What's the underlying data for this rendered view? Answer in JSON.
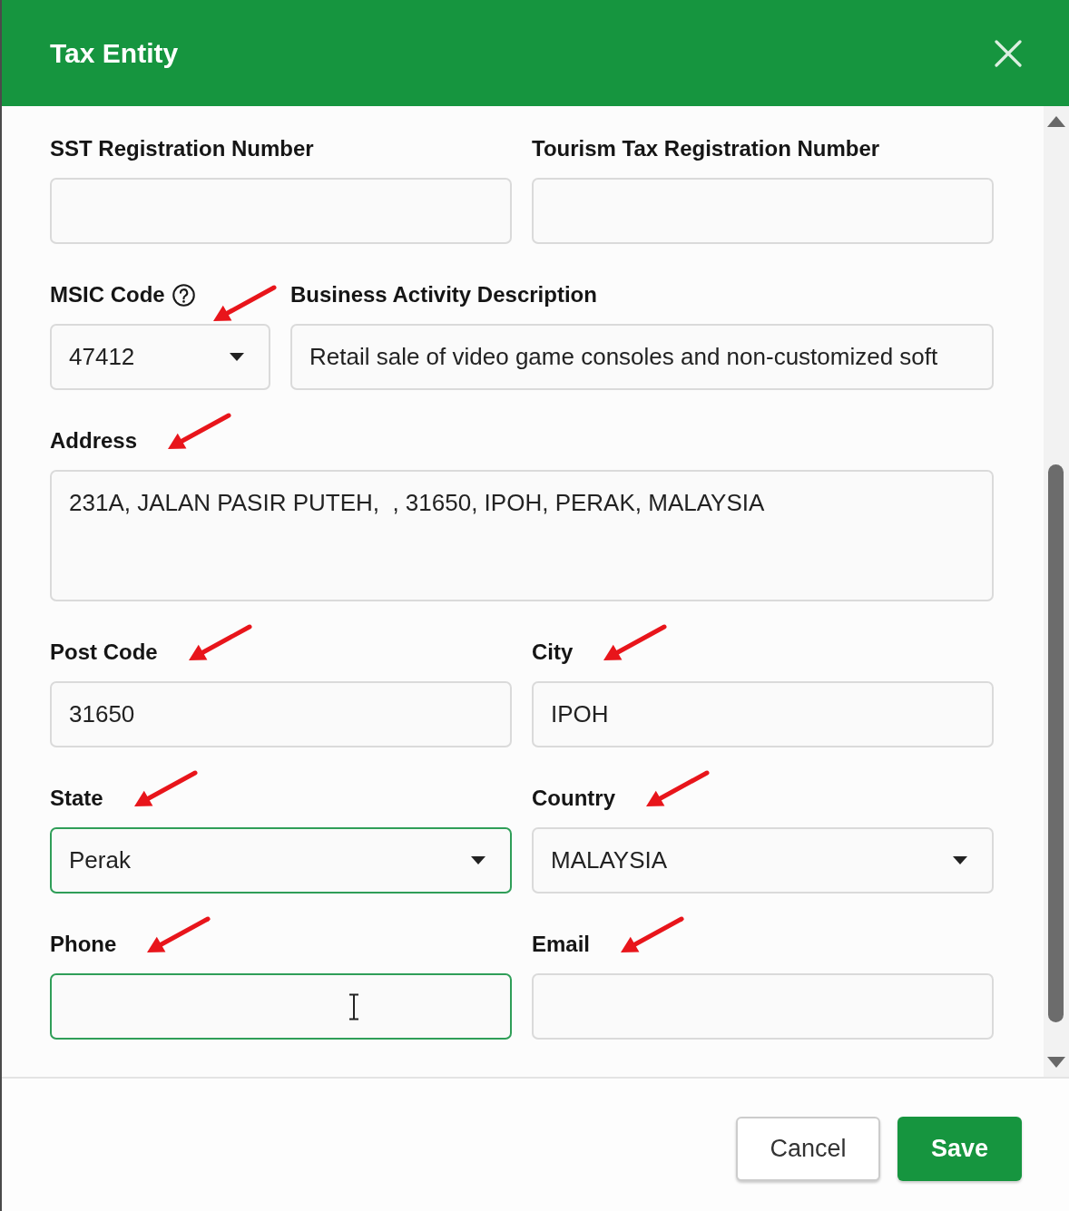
{
  "dialog": {
    "title": "Tax Entity"
  },
  "form": {
    "rows": [
      {
        "fields": [
          {
            "label": "SST Registration Number",
            "kind": "text",
            "help": false,
            "marked": false,
            "highlighted": false,
            "hovered": false
          },
          {
            "label": "Tourism Tax Registration Number",
            "kind": "text",
            "help": false,
            "marked": false,
            "highlighted": false,
            "hovered": false
          }
        ]
      },
      {
        "fields": [
          {
            "label": "MSIC Code",
            "kind": "select",
            "value": "47412",
            "help": true,
            "marked": true,
            "highlighted": false,
            "hovered": false
          },
          {
            "label": "Business Activity Description",
            "kind": "text",
            "value": "Retail sale of video game consoles and non-customized soft",
            "help": false,
            "marked": false,
            "highlighted": false,
            "hovered": false
          }
        ]
      },
      {
        "fields": [
          {
            "label": "Address",
            "kind": "textarea",
            "value": "231A, JALAN PASIR PUTEH,  , 31650, IPOH, PERAK, MALAYSIA",
            "help": false,
            "marked": true,
            "highlighted": false,
            "hovered": false
          }
        ]
      },
      {
        "fields": [
          {
            "label": "Post Code",
            "kind": "text",
            "value": "31650",
            "help": false,
            "marked": true,
            "highlighted": false,
            "hovered": false
          },
          {
            "label": "City",
            "kind": "text",
            "value": "IPOH",
            "help": false,
            "marked": true,
            "highlighted": false,
            "hovered": false
          }
        ]
      },
      {
        "fields": [
          {
            "label": "State",
            "kind": "select",
            "value": "Perak",
            "help": false,
            "marked": true,
            "highlighted": true,
            "hovered": false
          },
          {
            "label": "Country",
            "kind": "select",
            "value": "MALAYSIA",
            "help": false,
            "marked": true,
            "highlighted": false,
            "hovered": false
          }
        ]
      },
      {
        "fields": [
          {
            "label": "Phone",
            "kind": "text",
            "help": false,
            "marked": true,
            "highlighted": true,
            "hovered": true
          },
          {
            "label": "Email",
            "kind": "text",
            "help": false,
            "marked": true,
            "highlighted": false,
            "hovered": false
          }
        ]
      }
    ]
  },
  "buttons": [
    {
      "label": "Cancel",
      "kind": "secondary"
    },
    {
      "label": "Save",
      "kind": "primary"
    }
  ]
}
